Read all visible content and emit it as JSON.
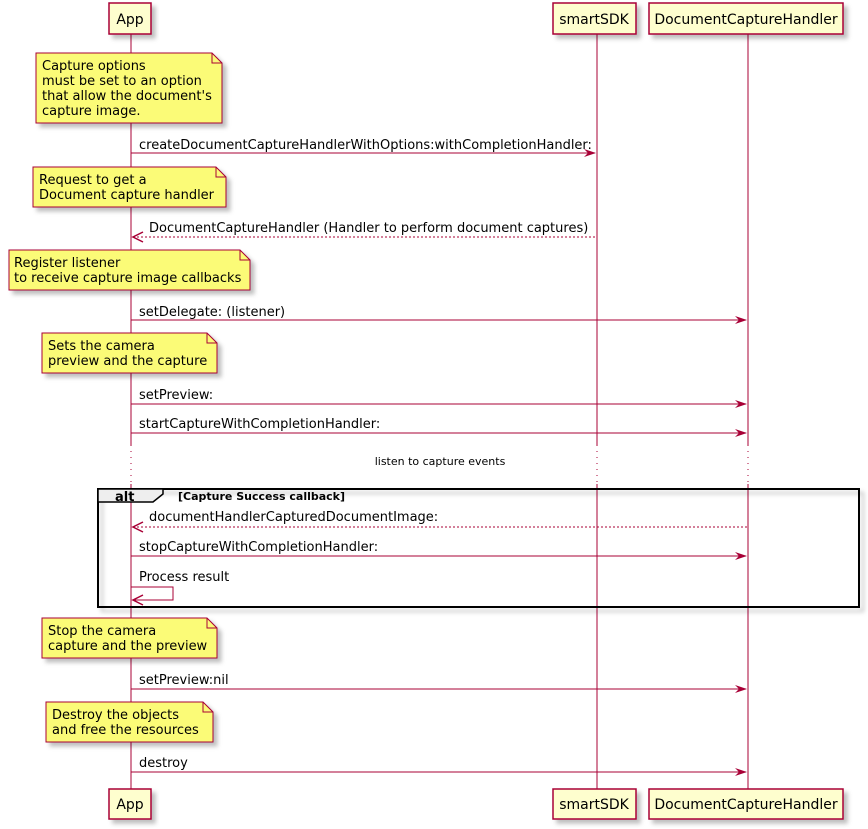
{
  "diagram": {
    "type": "sequence",
    "colors": {
      "line": "#A80036",
      "participant_fill": "#FEFECE",
      "note_fill": "#FBFB77",
      "frame_border": "#000000",
      "alt_header_fill": "#EEEEEE"
    },
    "participants": [
      {
        "id": "app",
        "label": "App"
      },
      {
        "id": "sdk",
        "label": "smartSDK"
      },
      {
        "id": "dch",
        "label": "DocumentCaptureHandler"
      }
    ],
    "notes": [
      {
        "lines": [
          "Capture options",
          "must be set to an option",
          "that allow the document's",
          "capture image."
        ]
      },
      {
        "lines": [
          "Request to get a",
          "Document capture handler"
        ]
      },
      {
        "lines": [
          "Register listener",
          "to receive capture image callbacks"
        ]
      },
      {
        "lines": [
          "Sets the camera",
          "preview and the capture"
        ]
      },
      {
        "lines": [
          "Stop the camera",
          "capture and the preview"
        ]
      },
      {
        "lines": [
          "Destroy the objects",
          "and free the resources"
        ]
      }
    ],
    "messages": [
      {
        "from": "app",
        "to": "sdk",
        "label": "createDocumentCaptureHandlerWithOptions:withCompletionHandler:",
        "style": "solid"
      },
      {
        "from": "sdk",
        "to": "app",
        "label": "DocumentCaptureHandler (Handler to perform document captures)",
        "style": "dashed"
      },
      {
        "from": "app",
        "to": "dch",
        "label": "setDelegate: (listener)",
        "style": "solid"
      },
      {
        "from": "app",
        "to": "dch",
        "label": "setPreview:",
        "style": "solid"
      },
      {
        "from": "app",
        "to": "dch",
        "label": "startCaptureWithCompletionHandler:",
        "style": "solid"
      },
      {
        "from": "dch",
        "to": "app",
        "label": "documentHandlerCapturedDocumentImage:",
        "style": "dashed"
      },
      {
        "from": "app",
        "to": "dch",
        "label": "stopCaptureWithCompletionHandler:",
        "style": "solid"
      },
      {
        "from": "app",
        "to": "app",
        "label": "Process result",
        "style": "solid"
      },
      {
        "from": "app",
        "to": "dch",
        "label": "setPreview:nil",
        "style": "solid"
      },
      {
        "from": "app",
        "to": "dch",
        "label": "destroy",
        "style": "solid"
      }
    ],
    "delay": {
      "label": "listen to capture events"
    },
    "alt_frame": {
      "keyword": "alt",
      "condition": "[Capture Success callback]"
    }
  }
}
